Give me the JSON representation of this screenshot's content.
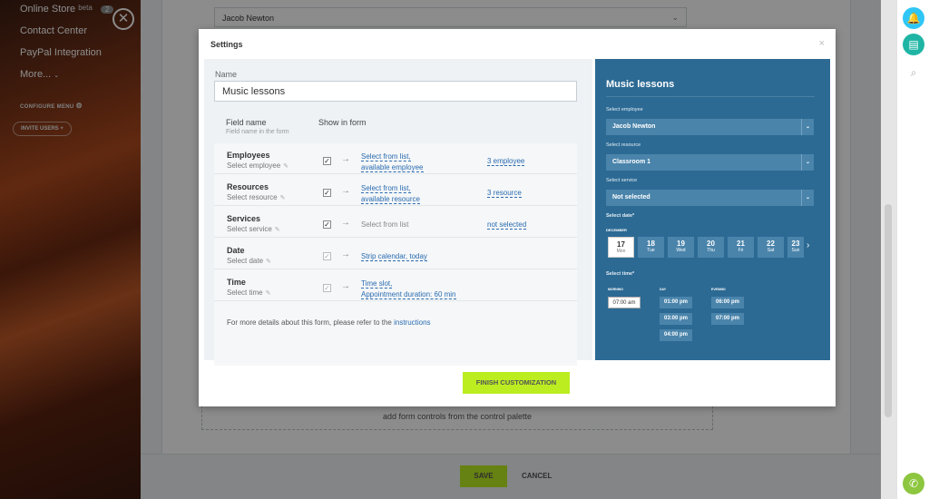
{
  "sidebar": {
    "items": [
      {
        "label": "Online Store",
        "suffix": "beta",
        "badge": "2"
      },
      {
        "label": "Contact Center"
      },
      {
        "label": "PayPal Integration"
      },
      {
        "label": "More... "
      }
    ],
    "configure_menu": "CONFIGURE MENU",
    "invite_users": "INVITE USERS"
  },
  "background": {
    "employee_select": "Jacob Newton",
    "dropzone_text": "add form controls from the control palette",
    "save": "SAVE",
    "cancel": "CANCEL"
  },
  "modal": {
    "title": "Settings",
    "name_label": "Name",
    "name_value": "Music lessons",
    "col_field_name": "Field name",
    "col_field_sub": "Field name in the form",
    "col_show_in_form": "Show in form",
    "rows": [
      {
        "name": "Employees",
        "sub": "Select employee",
        "checked": true,
        "source_1": "Select from list,",
        "source_2": "available employee",
        "count": "3 employee"
      },
      {
        "name": "Resources",
        "sub": "Select resource",
        "checked": true,
        "source_1": "Select from list,",
        "source_2": "available resource",
        "count": "3 resource"
      },
      {
        "name": "Services",
        "sub": "Select service",
        "checked": true,
        "source_1": "Select from list",
        "source_2": "",
        "count": "not selected"
      },
      {
        "name": "Date",
        "sub": "Select date",
        "checked": true,
        "source_1": "Strip calendar, today",
        "source_2": "",
        "count": ""
      },
      {
        "name": "Time",
        "sub": "Select time",
        "checked": true,
        "source_1": "Time slot,",
        "source_2": "Appointment duration: 60 min",
        "count": ""
      }
    ],
    "details_text": "For more details about this form, please refer to the ",
    "details_link": "instructions",
    "finish_button": "FINISH CUSTOMIZATION"
  },
  "preview": {
    "title": "Music lessons",
    "employee_label": "Select employee",
    "employee_value": "Jacob Newton",
    "resource_label": "Select resource",
    "resource_value": "Classroom 1",
    "service_label": "Select service",
    "service_value": "Not selected",
    "date_label": "Select date*",
    "month": "DECEMBER",
    "days": [
      {
        "n": "17",
        "w": "Mon",
        "active": true
      },
      {
        "n": "18",
        "w": "Tue"
      },
      {
        "n": "19",
        "w": "Wed"
      },
      {
        "n": "20",
        "w": "Thu"
      },
      {
        "n": "21",
        "w": "Fri"
      },
      {
        "n": "22",
        "w": "Sat"
      },
      {
        "n": "23",
        "w": "Sun"
      }
    ],
    "time_label": "Select time*",
    "morning": "MORNING",
    "day": "DAY",
    "evening": "EVENING",
    "morning_slots": [
      "07:00 am"
    ],
    "day_slots": [
      "01:00 pm",
      "03:00 pm",
      "04:00 pm"
    ],
    "evening_slots": [
      "06:00 pm",
      "07:00 pm"
    ]
  },
  "colors": {
    "accent_green": "#bbed21",
    "preview_blue": "#2c6a94",
    "link_blue": "#2a6bb0"
  }
}
